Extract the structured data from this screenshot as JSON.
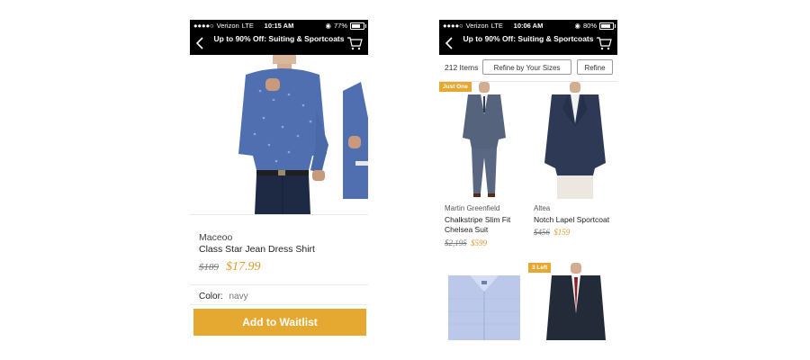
{
  "left": {
    "status": {
      "carrier": "Verizon",
      "network": "LTE",
      "time": "10:15 AM",
      "battery": "77%",
      "battery_level": 0.77
    },
    "nav_title": "Up to 90% Off: Suiting & Sportcoats",
    "product": {
      "brand": "Maceoo",
      "name": "Class Star Jean Dress Shirt",
      "old_price": "$189",
      "new_price": "$17.99",
      "color_label": "Color:",
      "color_value": "navy"
    },
    "cta": "Add to Waitlist"
  },
  "right": {
    "status": {
      "carrier": "Verizon",
      "network": "LTE",
      "time": "10:06 AM",
      "battery": "80%",
      "battery_level": 0.8
    },
    "nav_title": "Up to 90% Off: Suiting & Sportcoats",
    "items_count": "212 Items",
    "refine_size": "Refine by Your Sizes",
    "refine": "Refine",
    "products": [
      {
        "badge": "Just One",
        "brand": "Martin Greenfield",
        "name": "Chalkstripe Slim Fit Chelsea Suit",
        "old_price": "$2,195",
        "new_price": "$599"
      },
      {
        "badge": "",
        "brand": "Altea",
        "name": "Notch Lapel Sportcoat",
        "old_price": "$456",
        "new_price": "$159"
      },
      {
        "badge": "",
        "brand": "",
        "name": "",
        "old_price": "",
        "new_price": ""
      },
      {
        "badge": "3 Left",
        "brand": "",
        "name": "",
        "old_price": "",
        "new_price": ""
      }
    ]
  },
  "colors": {
    "accent": "#e5a830",
    "sale_price": "#e19a2e",
    "bar": "#000000"
  }
}
